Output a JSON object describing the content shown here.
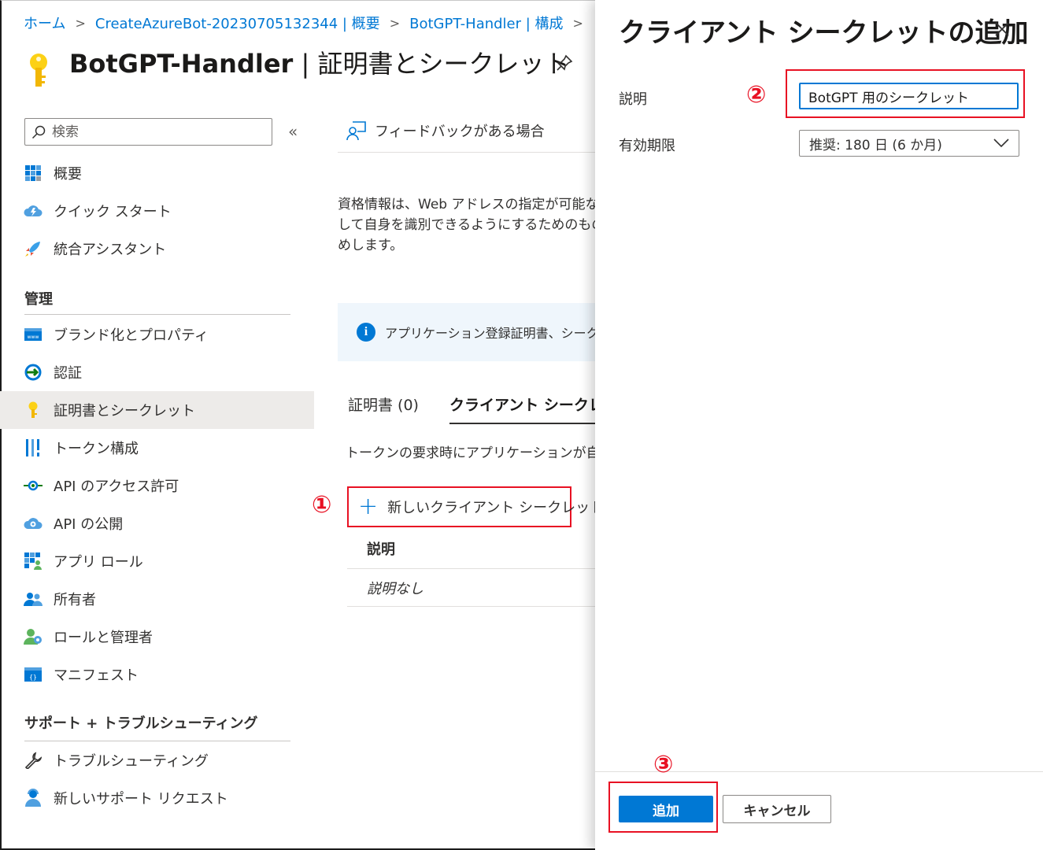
{
  "breadcrumb": {
    "items": [
      "ホーム",
      "CreateAzureBot-20230705132344 | 概要",
      "BotGPT-Handler | 構成"
    ],
    "separator": ">"
  },
  "header": {
    "title_app": "BotGPT-Handler",
    "title_sep": " | ",
    "title_page": "証明書とシークレット",
    "icon": "key-icon",
    "pin_icon": "pin-icon"
  },
  "search": {
    "placeholder": "検索",
    "collapse_icon": "«"
  },
  "nav": {
    "top_items": [
      {
        "label": "概要",
        "icon": "overview-grid-icon"
      },
      {
        "label": "クイック スタート",
        "icon": "cloud-lightning-icon"
      },
      {
        "label": "統合アシスタント",
        "icon": "rocket-icon"
      }
    ],
    "manage_header": "管理",
    "manage_items": [
      {
        "label": "ブランド化とプロパティ",
        "icon": "www-icon"
      },
      {
        "label": "認証",
        "icon": "auth-arrow-icon"
      },
      {
        "label": "証明書とシークレット",
        "icon": "key-icon",
        "selected": true
      },
      {
        "label": "トークン構成",
        "icon": "token-bars-icon"
      },
      {
        "label": "API のアクセス許可",
        "icon": "api-permission-icon"
      },
      {
        "label": "API の公開",
        "icon": "cloud-gear-icon"
      },
      {
        "label": "アプリ ロール",
        "icon": "app-roles-icon"
      },
      {
        "label": "所有者",
        "icon": "owners-icon"
      },
      {
        "label": "ロールと管理者",
        "icon": "roles-admin-icon"
      },
      {
        "label": "マニフェスト",
        "icon": "manifest-icon"
      }
    ],
    "support_header": "サポート + トラブルシューティング",
    "support_items": [
      {
        "label": "トラブルシューティング",
        "icon": "wrench-icon"
      },
      {
        "label": "新しいサポート リクエスト",
        "icon": "support-person-icon"
      }
    ]
  },
  "main": {
    "feedback": "フィードバックがある場合",
    "description_lines": [
      "資格情報は、Web アドレスの指定が可能な",
      "して自身を識別できるようにするためのもので",
      "めします。"
    ],
    "info_text": "アプリケーション登録証明書、シークレッ",
    "tabs": [
      "証明書 (0)",
      "クライアント シークレット"
    ],
    "tokens_desc": "トークンの要求時にアプリケーションが自身の",
    "new_secret_button": "新しいクライアント シークレット",
    "table_header": "説明",
    "table_empty": "説明なし",
    "marker1": "①"
  },
  "panel": {
    "title": "クライアント シークレットの追加",
    "description_label": "説明",
    "description_value": "BotGPT 用のシークレット",
    "expiry_label": "有効期限",
    "expiry_value": "推奨: 180 日 (6 か月)",
    "add_button": "追加",
    "cancel_button": "キャンセル",
    "marker2": "②",
    "marker3": "③"
  },
  "colors": {
    "accent": "#0078d4",
    "highlight": "#e81123",
    "selected_bg": "#edebe9"
  }
}
